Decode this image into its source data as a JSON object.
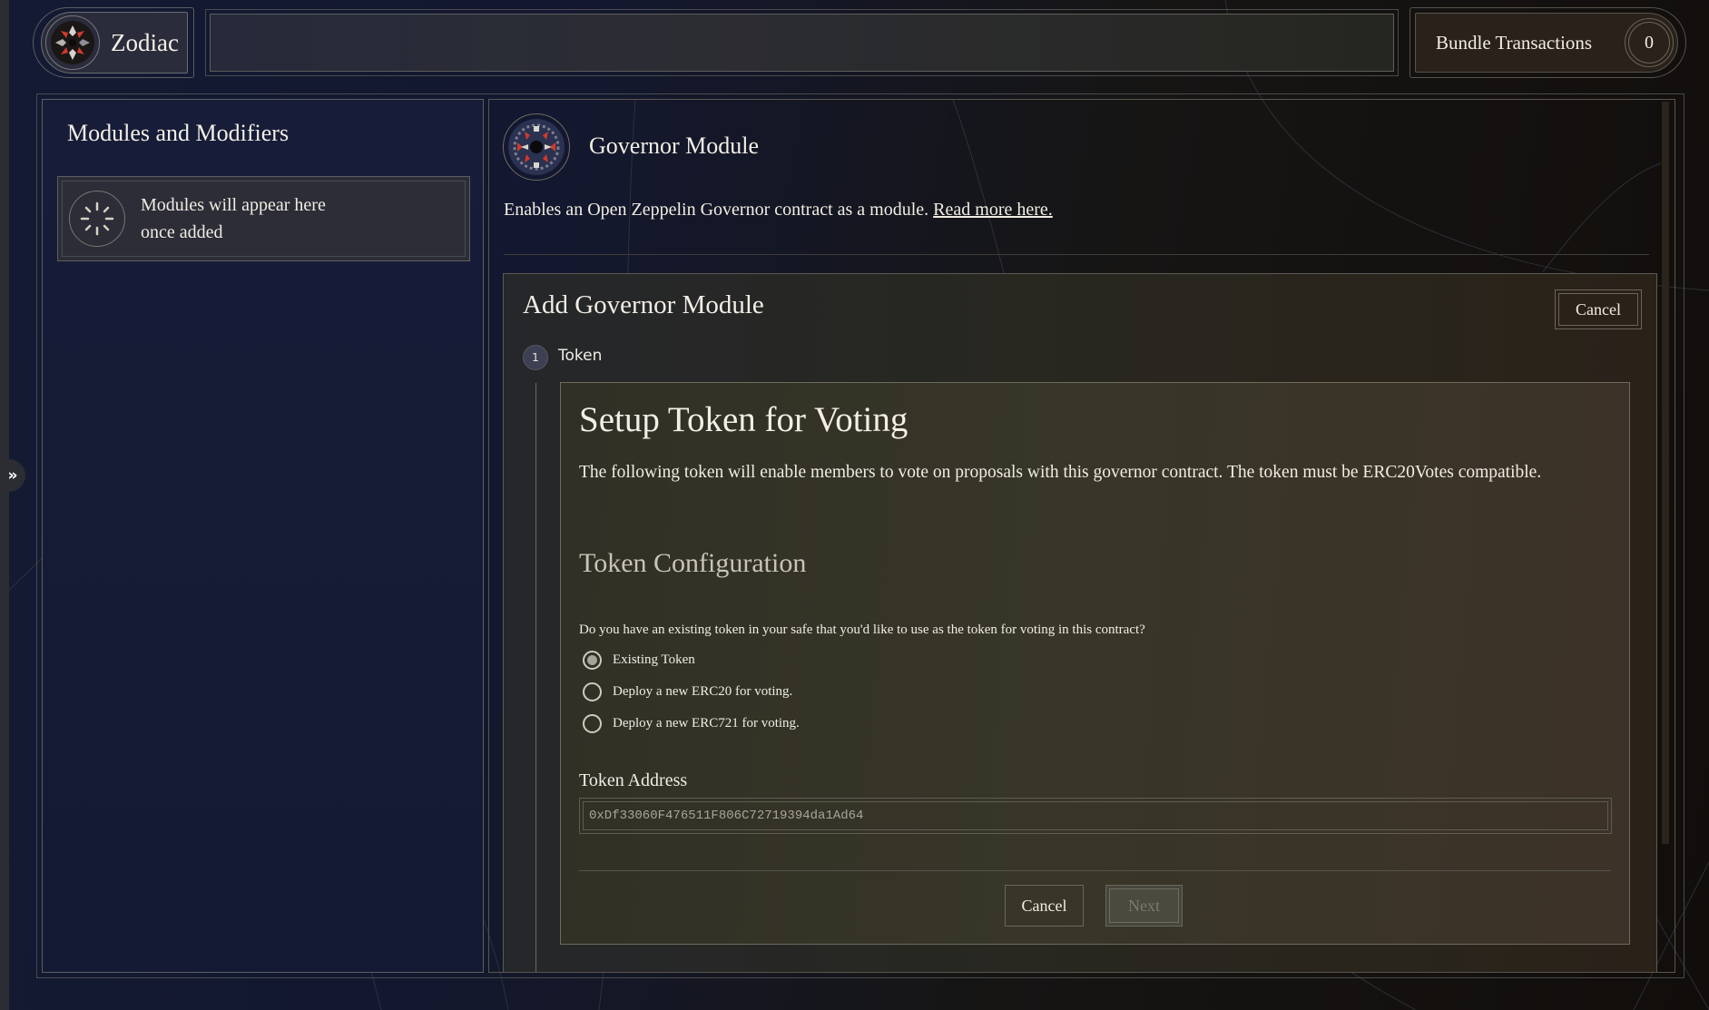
{
  "app": {
    "name": "Zodiac",
    "logo_icon": "zodiac-logo-icon"
  },
  "header": {
    "bundle_label": "Bundle Transactions",
    "bundle_count": "0"
  },
  "sidebar": {
    "toggle_icon": "double-chevron-right-icon",
    "title": "Modules and Modifiers",
    "empty_state": {
      "icon": "loading-spinner-icon",
      "line1": "Modules will appear here",
      "line2": "once added"
    }
  },
  "module": {
    "icon": "governor-module-icon",
    "title": "Governor Module",
    "description": "Enables an Open Zeppelin Governor contract as a module.",
    "link_text": "Read more here."
  },
  "add_form": {
    "title": "Add Governor Module",
    "cancel_label": "Cancel",
    "steps": [
      {
        "number": "1",
        "label": "Token"
      }
    ],
    "setup": {
      "title": "Setup Token for Voting",
      "description": "The following token will enable members to vote on proposals with this governor contract. The token must be ERC20Votes compatible.",
      "config_title": "Token Configuration",
      "question": "Do you have an existing token in your safe that you'd like to use as the token for voting in this contract?",
      "options": [
        {
          "label": "Existing Token",
          "checked": true
        },
        {
          "label": "Deploy a new ERC20 for voting.",
          "checked": false
        },
        {
          "label": "Deploy a new ERC721 for voting.",
          "checked": false
        }
      ],
      "token_address_label": "Token Address",
      "token_address_value": "0xDf33060F476511F806C72719394da1Ad64",
      "cancel_label": "Cancel",
      "next_label": "Next",
      "next_disabled": true
    }
  },
  "colors": {
    "background_left": "#141a33",
    "background_right": "#110d0b",
    "text": "#f1ede4",
    "border": "#5e5e60"
  }
}
